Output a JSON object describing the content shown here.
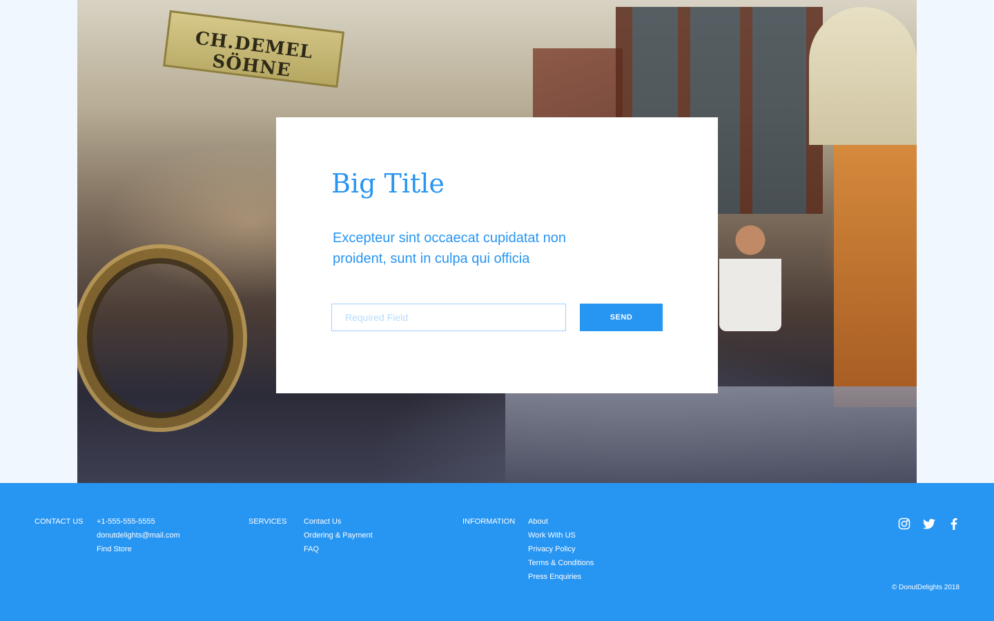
{
  "card": {
    "title": "Big Title",
    "description": "Excepteur sint occaecat cupidatat non proident, sunt in culpa qui officia",
    "field_placeholder": "Required Field",
    "send_label": "SEND"
  },
  "hero": {
    "sign_text": "CH.DEMEL SÖHNE"
  },
  "footer": {
    "contact": {
      "heading": "CONTACT US",
      "items": [
        "+1-555-555-5555",
        "donutdelights@mail.com",
        "Find  Store"
      ]
    },
    "services": {
      "heading": "SERVICES",
      "items": [
        "Contact Us",
        "Ordering & Payment",
        "FAQ"
      ]
    },
    "information": {
      "heading": "INFORMATION",
      "items": [
        "About",
        "Work With US",
        "Privacy Policy",
        "Terms & Conditions",
        "Press Enquiries"
      ]
    },
    "social_icons": [
      "instagram-icon",
      "twitter-icon",
      "facebook-icon"
    ],
    "copyright": "© DonutDelights 2018"
  },
  "colors": {
    "accent": "#2795f2",
    "page_background": "#f0f7ff",
    "field_border": "#9ccfff"
  }
}
